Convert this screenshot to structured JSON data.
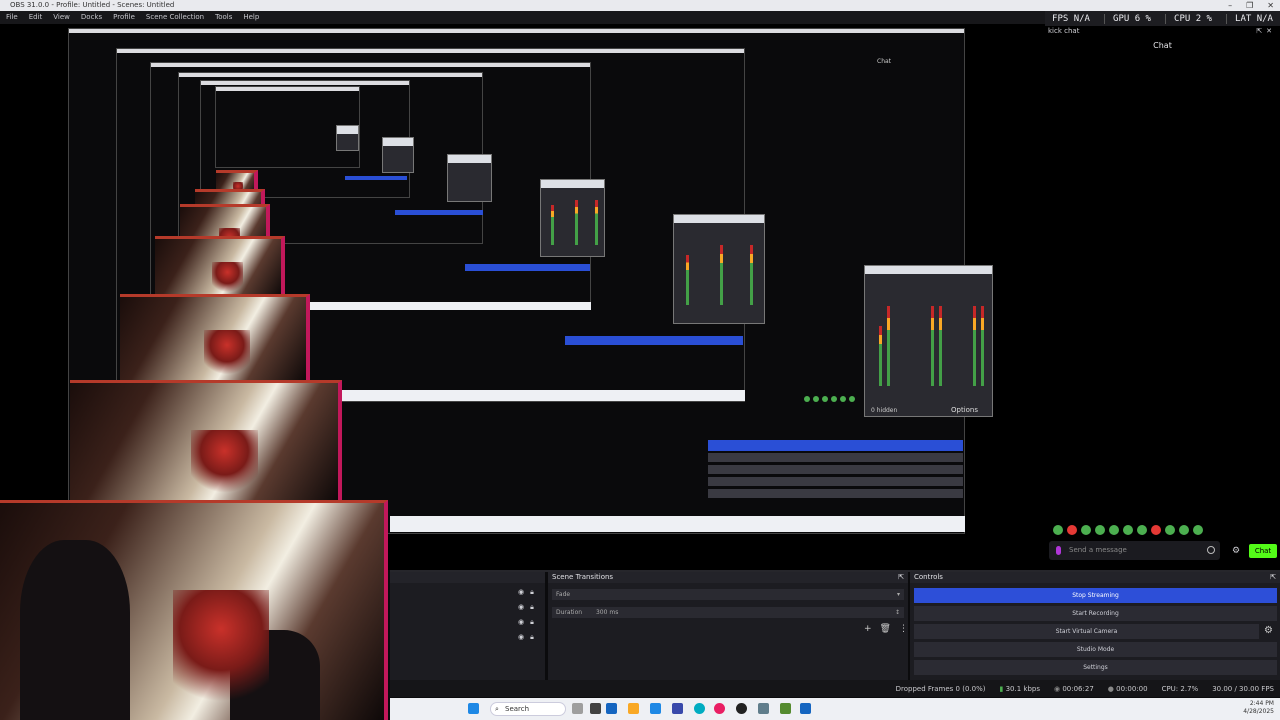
{
  "window": {
    "title": "OBS 31.0.0 - Profile: Untitled - Scenes: Untitled",
    "controls": [
      "–",
      "❐",
      "✕"
    ]
  },
  "menu": [
    "File",
    "Edit",
    "View",
    "Docks",
    "Profile",
    "Scene Collection",
    "Tools",
    "Help"
  ],
  "stats": {
    "fps": "FPS N/A",
    "gpu": "GPU 6 %",
    "cpu": "CPU 2 %",
    "lat": "LAT N/A"
  },
  "kick_chat": {
    "dock_title": "kick chat",
    "header": "Chat",
    "input_placeholder": "Send a message",
    "send_label": "Chat"
  },
  "scene_transitions": {
    "title": "Scene Transitions",
    "transition": "Fade",
    "duration_label": "Duration",
    "duration_value": "300 ms"
  },
  "controls": {
    "title": "Controls",
    "buttons": [
      "Stop Streaming",
      "Start Recording",
      "Start Virtual Camera",
      "Studio Mode",
      "Settings"
    ]
  },
  "status": {
    "dropped": "Dropped Frames 0 (0.0%)",
    "bitrate": "30.1 kbps",
    "stream_time": "00:06:27",
    "rec_time": "00:00:00",
    "cpu": "CPU: 2.7%",
    "fps": "30.00 / 30.00 FPS"
  },
  "taskbar": {
    "search": "Search",
    "time": "2:44 PM",
    "date": "4/28/2025"
  },
  "preview": {
    "mixer_options": "Options",
    "hidden_label": "0 hidden",
    "chat_label": "Chat"
  }
}
